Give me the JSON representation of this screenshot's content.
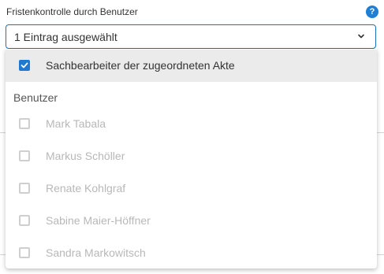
{
  "field": {
    "label": "Fristenkontrolle durch Benutzer",
    "help_icon": "question-circle-icon",
    "help_glyph": "?",
    "selected_value": "1 Eintrag ausgewählt",
    "chevron_icon": "chevron-down-icon"
  },
  "dropdown": {
    "selected_option": {
      "label": "Sachbearbeiter der zugeordneten Akte",
      "checked": true
    },
    "group_header": "Benutzer",
    "options": [
      {
        "label": "Mark Tabala",
        "checked": false,
        "disabled": true
      },
      {
        "label": "Markus Schöller",
        "checked": false,
        "disabled": true
      },
      {
        "label": "Renate Kohlgraf",
        "checked": false,
        "disabled": true
      },
      {
        "label": "Sabine Maier-Höffner",
        "checked": false,
        "disabled": true
      },
      {
        "label": "Sandra Markowitsch",
        "checked": false,
        "disabled": true
      }
    ]
  },
  "colors": {
    "accent": "#1f78d1",
    "selected_bg": "#ebebeb",
    "disabled_text": "#b8b8b8"
  }
}
